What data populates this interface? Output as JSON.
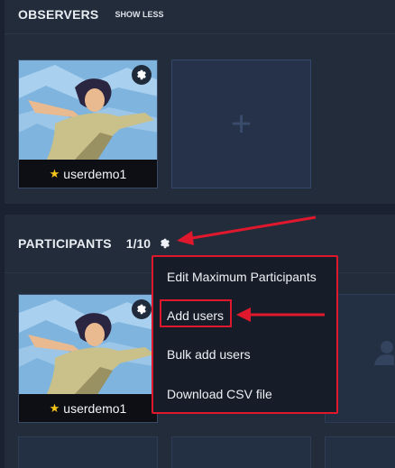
{
  "observers": {
    "title": "OBSERVERS",
    "toggle_label": "SHOW LESS",
    "user": {
      "name": "userdemo1",
      "star": "★"
    }
  },
  "participants": {
    "title": "PARTICIPANTS",
    "count": "1/10",
    "user": {
      "name": "userdemo1",
      "star": "★"
    }
  },
  "menu": {
    "items": [
      "Edit Maximum Participants",
      "Add users",
      "Bulk add users",
      "Download CSV file"
    ]
  },
  "empty_slot_symbol": "+",
  "colors": {
    "annotation": "#e0182d",
    "star": "#f5c518",
    "panel": "#222c3b"
  }
}
